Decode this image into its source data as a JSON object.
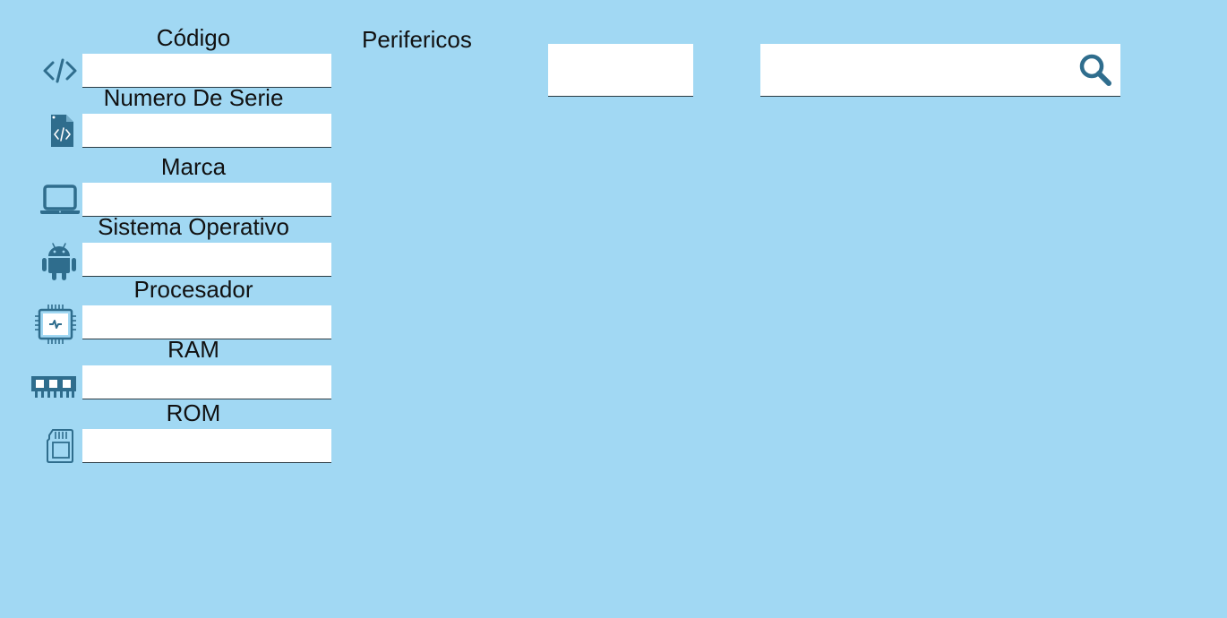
{
  "form": {
    "fields": [
      {
        "label": "Código",
        "icon": "code-icon",
        "value": ""
      },
      {
        "label": "Numero De Serie",
        "icon": "code-file-icon",
        "value": ""
      },
      {
        "label": "Marca",
        "icon": "laptop-icon",
        "value": ""
      },
      {
        "label": "Sistema Operativo",
        "icon": "android-icon",
        "value": ""
      },
      {
        "label": "Procesador",
        "icon": "cpu-chip-icon",
        "value": ""
      },
      {
        "label": "RAM",
        "icon": "ram-memory-icon",
        "value": ""
      },
      {
        "label": "ROM",
        "icon": "sd-card-icon",
        "value": ""
      }
    ]
  },
  "peripherals": {
    "label": "Perifericos",
    "value": ""
  },
  "search": {
    "value": "",
    "icon": "search-icon"
  },
  "colors": {
    "background": "#a1d8f3",
    "icon": "#2f6d8d",
    "field": "#ffffff"
  }
}
